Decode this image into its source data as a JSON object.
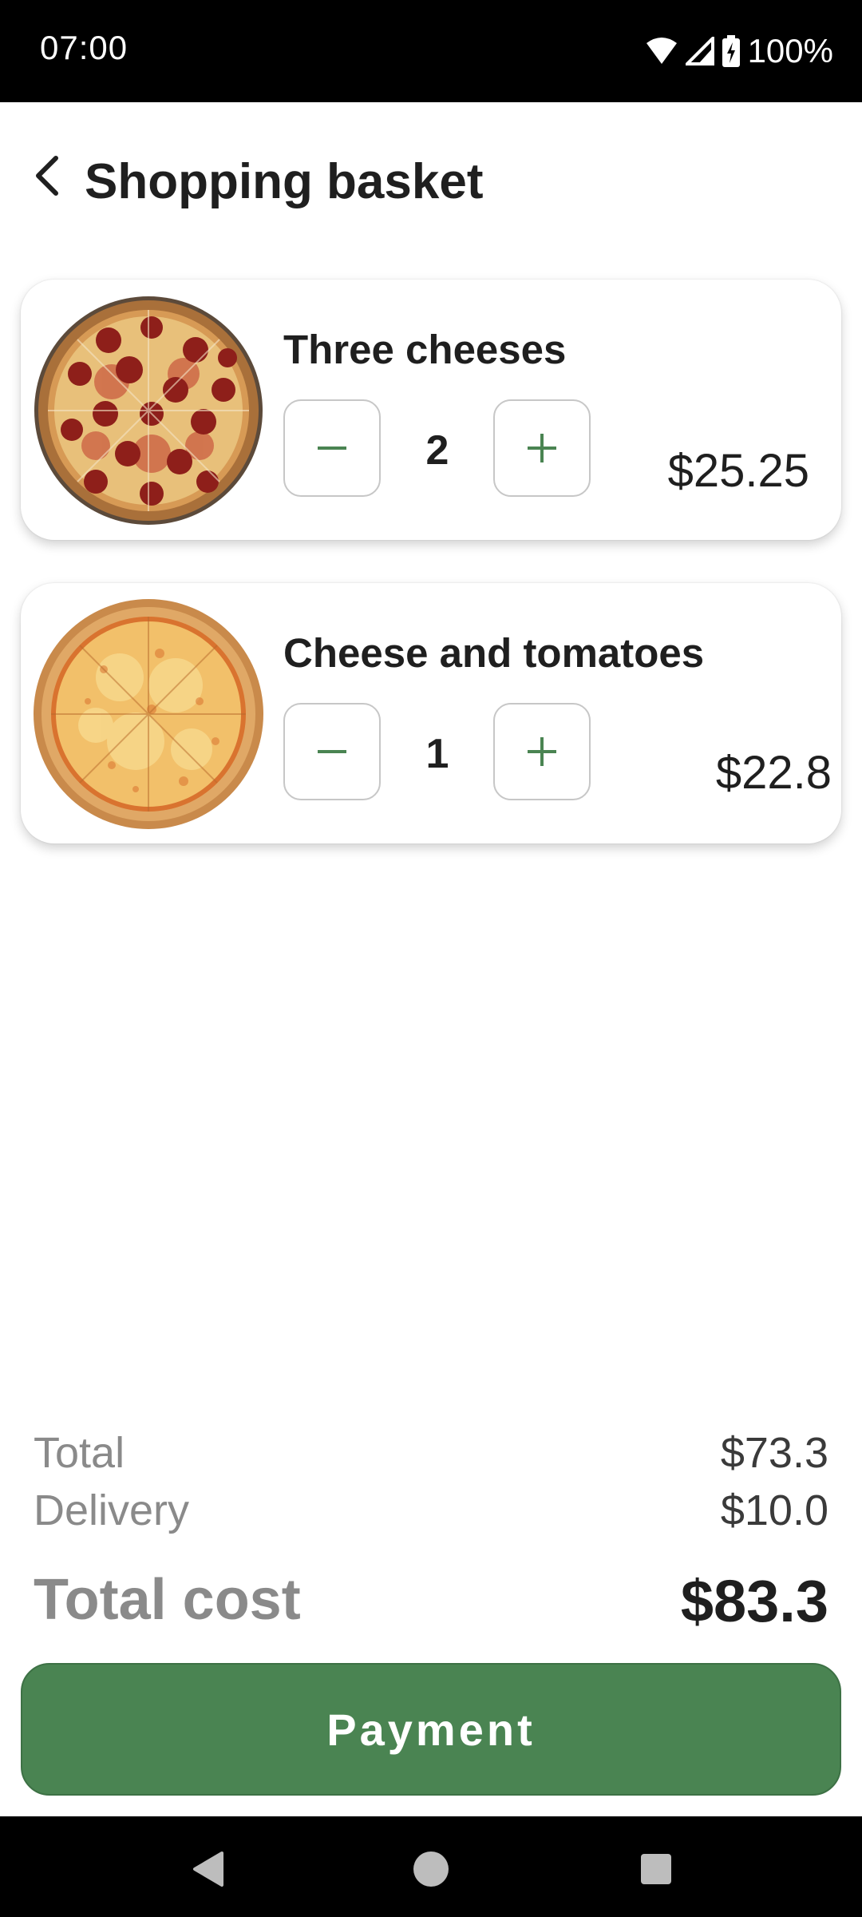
{
  "status_bar": {
    "time": "07:00",
    "battery": "100%",
    "icons": [
      "wifi-icon",
      "signal-icon",
      "battery-charging-icon"
    ]
  },
  "header": {
    "back_icon": "chevron-left-icon",
    "title": "Shopping basket"
  },
  "basket": {
    "items": [
      {
        "name": "Three cheeses",
        "quantity": "2",
        "price": "$25.25",
        "image": "pepperoni-pizza-image"
      },
      {
        "name": "Cheese and tomatoes",
        "quantity": "1",
        "price": "$22.8",
        "image": "cheese-pizza-image"
      }
    ],
    "minus_icon": "minus-icon",
    "plus_icon": "plus-icon"
  },
  "summary": {
    "total_label": "Total",
    "total_value": "$73.3",
    "delivery_label": "Delivery",
    "delivery_value": "$10.0",
    "total_cost_label": "Total cost",
    "total_cost_value": "$83.3"
  },
  "payment_button": {
    "label": "Payment"
  },
  "colors": {
    "accent": "#4a8452",
    "stepper_icon": "#4a8452",
    "muted_text": "#8a8a8a"
  },
  "nav_bar": {
    "icons": [
      "back-triangle-icon",
      "home-circle-icon",
      "recents-square-icon"
    ]
  }
}
